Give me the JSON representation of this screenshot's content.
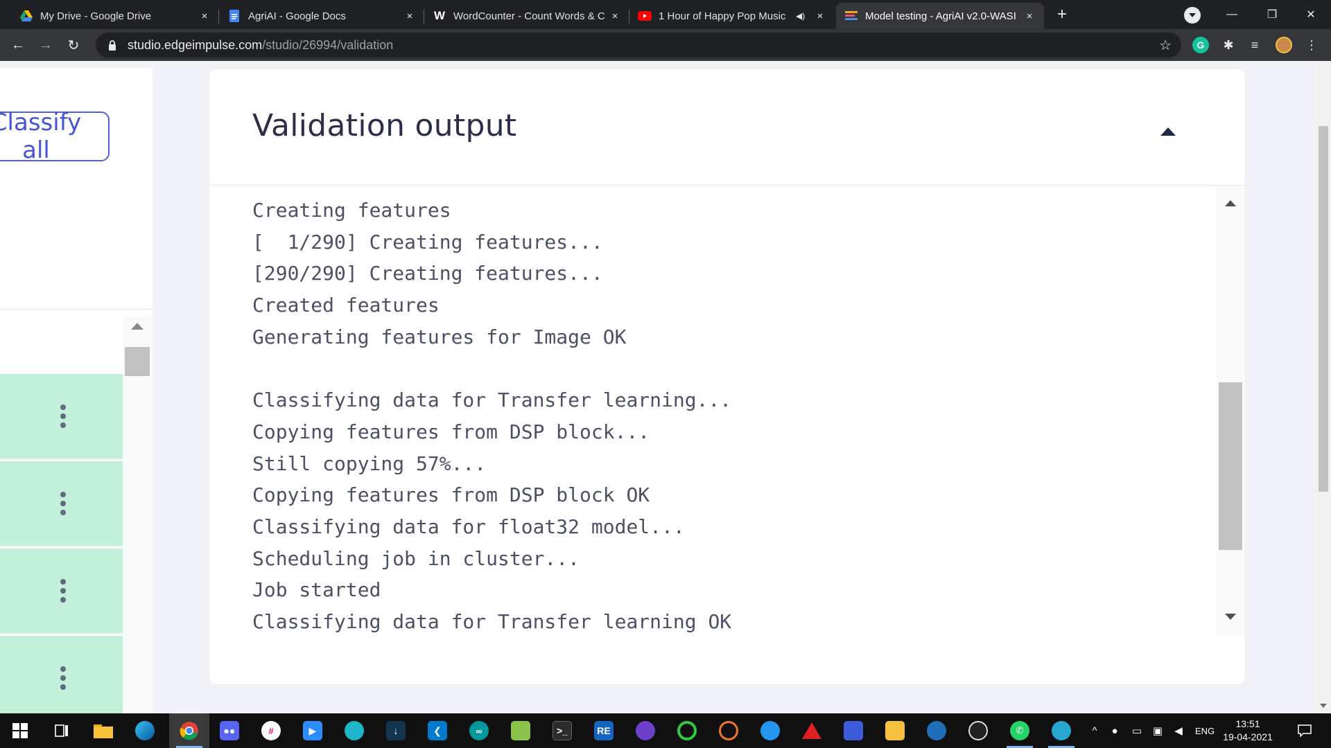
{
  "browser": {
    "tabs": [
      {
        "title": "My Drive - Google Drive",
        "icon": "google-drive-icon",
        "active": false
      },
      {
        "title": "AgriAI - Google Docs",
        "icon": "google-docs-icon",
        "active": false
      },
      {
        "title": "WordCounter - Count Words & C",
        "icon": "wordcounter-icon",
        "active": false
      },
      {
        "title": "1 Hour of Happy Pop Music",
        "icon": "youtube-icon",
        "active": false,
        "audio": true
      },
      {
        "title": "Model testing - AgriAI v2.0-WASI",
        "icon": "edge-impulse-icon",
        "active": true
      }
    ],
    "address": {
      "domain": "studio.edgeimpulse.com",
      "path": "/studio/26994/validation"
    },
    "icons": {
      "tab_close": "×",
      "new_tab": "+",
      "back": "←",
      "forward": "→",
      "reload": "↻",
      "bookmark": "☆",
      "extensions": "✱",
      "media": "≡",
      "grammarly_letter": "G",
      "menu": "⋮",
      "minimize": "—",
      "restore": "❐",
      "close": "✕",
      "speaker": "◀)"
    }
  },
  "page": {
    "left": {
      "classify_button_label": "Classify all",
      "rows_count_note": "",
      "rows": [
        {
          "menu_icon": "kebab-menu-icon"
        },
        {
          "menu_icon": "kebab-menu-icon"
        },
        {
          "menu_icon": "kebab-menu-icon"
        },
        {
          "menu_icon": "kebab-menu-icon"
        }
      ]
    },
    "validation": {
      "title": "Validation output",
      "log_lines": [
        "Creating features",
        "[  1/290] Creating features...",
        "[290/290] Creating features...",
        "Created features",
        "Generating features for Image OK",
        "",
        "Classifying data for Transfer learning...",
        "Copying features from DSP block...",
        "Still copying 57%...",
        "Copying features from DSP block OK",
        "Classifying data for float32 model...",
        "Scheduling job in cluster...",
        "Job started",
        "Classifying data for Transfer learning OK"
      ]
    }
  },
  "taskbar": {
    "apps": [
      {
        "name": "start-icon"
      },
      {
        "name": "task-view-icon"
      },
      {
        "name": "file-explorer-icon"
      },
      {
        "name": "edge-browser-icon"
      },
      {
        "name": "chrome-icon",
        "active": true
      },
      {
        "name": "discord-icon"
      },
      {
        "name": "slack-icon"
      },
      {
        "name": "zoom-icon"
      },
      {
        "name": "app-teal-icon"
      },
      {
        "name": "app-download-icon"
      },
      {
        "name": "vscode-icon"
      },
      {
        "name": "arduino-icon",
        "label": "∞"
      },
      {
        "name": "cube-app-icon"
      },
      {
        "name": "terminal-icon",
        "label": ">_"
      },
      {
        "name": "re-app-icon",
        "label": "RE"
      },
      {
        "name": "github-icon"
      },
      {
        "name": "circle-green-icon"
      },
      {
        "name": "jupyter-icon"
      },
      {
        "name": "docker-icon"
      },
      {
        "name": "acrobat-icon"
      },
      {
        "name": "network-app-icon"
      },
      {
        "name": "puzzle-app-icon"
      },
      {
        "name": "aperture-app-icon"
      },
      {
        "name": "obs-icon"
      },
      {
        "name": "whatsapp-icon"
      },
      {
        "name": "app-teal2-icon"
      }
    ],
    "tray": {
      "language": "ENG",
      "time": "13:51",
      "date": "19-04-2021"
    }
  },
  "colors": {
    "accent": "#4655d4",
    "row_highlight": "#c3f0da",
    "page_bg": "#f1f3f8",
    "title": "#2b2f47",
    "log_text": "#4a5165"
  }
}
